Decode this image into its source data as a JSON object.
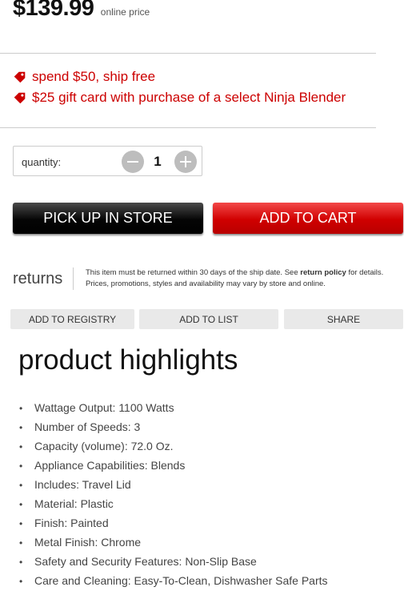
{
  "price": {
    "amount": "$139.99",
    "label": "online price"
  },
  "promos": [
    {
      "icon": "tag-icon",
      "text": "spend $50, ship free"
    },
    {
      "icon": "tag-icon",
      "text": "$25 gift card with purchase of a select Ninja Blender"
    }
  ],
  "quantity": {
    "label": "quantity:",
    "value": "1"
  },
  "buttons": {
    "pickup": "PICK UP IN STORE",
    "add_to_cart": "ADD TO CART"
  },
  "returns": {
    "title": "returns",
    "line1_prefix": "This item must be returned within 30 days of the ship date. See ",
    "policy_link": "return policy",
    "line1_suffix": " for details.",
    "line2": "Prices, promotions, styles and availability may vary by store and online."
  },
  "actions": {
    "registry": "ADD TO REGISTRY",
    "list": "ADD TO LIST",
    "share": "SHARE"
  },
  "highlights": {
    "title": "product highlights",
    "bullet": "•",
    "items": [
      "Wattage Output: 1100 Watts",
      "Number of Speeds: 3",
      "Capacity (volume): 72.0 Oz.",
      "Appliance Capabilities: Blends",
      "Includes: Travel Lid",
      "Material: Plastic",
      "Finish: Painted",
      "Metal Finish: Chrome",
      "Safety and Security Features: Non-Slip Base",
      "Care and Cleaning: Easy-To-Clean, Dishwasher Safe Parts"
    ]
  },
  "colors": {
    "accent_red": "#cc0000",
    "cart_red": "#d00000",
    "black_button": "#000000"
  }
}
